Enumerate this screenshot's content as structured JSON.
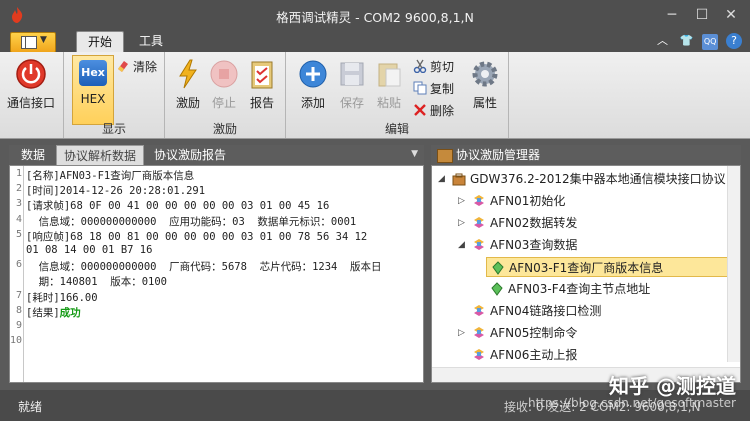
{
  "window": {
    "title": "格西调试精灵 - COM2  9600,8,1,N"
  },
  "ribbon_tabs": [
    {
      "label": "开始"
    },
    {
      "label": "工具"
    }
  ],
  "ribbon": {
    "groups": {
      "display": "显示",
      "stimulus": "激励",
      "edit": "编辑"
    },
    "buttons": {
      "comm_port": "通信接口",
      "hex": "HEX",
      "hex_icon_text": "Hex",
      "clear": "清除",
      "stimulate": "激励",
      "stop": "停止",
      "report": "报告",
      "add": "添加",
      "save": "保存",
      "paste": "粘贴",
      "cut": "剪切",
      "copy": "复制",
      "delete": "删除",
      "properties": "属性"
    }
  },
  "left_panel": {
    "tabs": [
      "数据",
      "协议解析数据",
      "协议激励报告"
    ],
    "lines": [
      {
        "num": "1",
        "text": "[名称]AFN03-F1查询厂商版本信息"
      },
      {
        "num": "2",
        "text": "[时间]2014-12-26 20:28:01.291"
      },
      {
        "num": "3",
        "text": "[请求帧]68 0F 00 41 00 00 00 00 00 03 01 00 45 16"
      },
      {
        "num": "4",
        "text": "  信息域：000000000000  应用功能码：03  数据单元标识：0001"
      },
      {
        "num": "5",
        "text": "[响应帧]68 18 00 81 00 00 00 00 00 03 01 00 78 56 34 12"
      },
      {
        "num": "",
        "text": "01 08 14 00 01 B7 16"
      },
      {
        "num": "6",
        "text": "  信息域：000000000000  厂商代码：5678  芯片代码：1234  版本日"
      },
      {
        "num": "",
        "text": "  期：140801  版本：0100"
      },
      {
        "num": "7",
        "text": "[耗时]166.00"
      },
      {
        "num": "8",
        "text": "[结果]"
      },
      {
        "num": "9",
        "text": ""
      },
      {
        "num": "10",
        "text": ""
      }
    ],
    "result_value": "成功"
  },
  "right_panel": {
    "title": "协议激励管理器",
    "tree": [
      {
        "label": "GDW376.2-2012集中器本地通信模块接口协议",
        "level": 0,
        "arrow": "down"
      },
      {
        "label": "AFN01初始化",
        "level": 1,
        "arrow": "right"
      },
      {
        "label": "AFN02数据转发",
        "level": 1,
        "arrow": "right"
      },
      {
        "label": "AFN03查询数据",
        "level": 1,
        "arrow": "down"
      },
      {
        "label": "AFN03-F1查询厂商版本信息",
        "level": 2,
        "arrow": "",
        "selected": true
      },
      {
        "label": "AFN03-F4查询主节点地址",
        "level": 2,
        "arrow": ""
      },
      {
        "label": "AFN04链路接口检测",
        "level": 1,
        "arrow": ""
      },
      {
        "label": "AFN05控制命令",
        "level": 1,
        "arrow": "right"
      },
      {
        "label": "AFN06主动上报",
        "level": 1,
        "arrow": ""
      }
    ]
  },
  "status": {
    "ready": "就绪",
    "info": "接收: 0  发送: 2  COM2: 9600,8,1,N"
  },
  "overlay": {
    "watermark": "知乎 @测控道",
    "url": "https://blog.csdn.net/gesoftmaster"
  },
  "colors": {
    "accent": "#f0a51c",
    "success": "#169b16",
    "selection": "#fde79a"
  }
}
